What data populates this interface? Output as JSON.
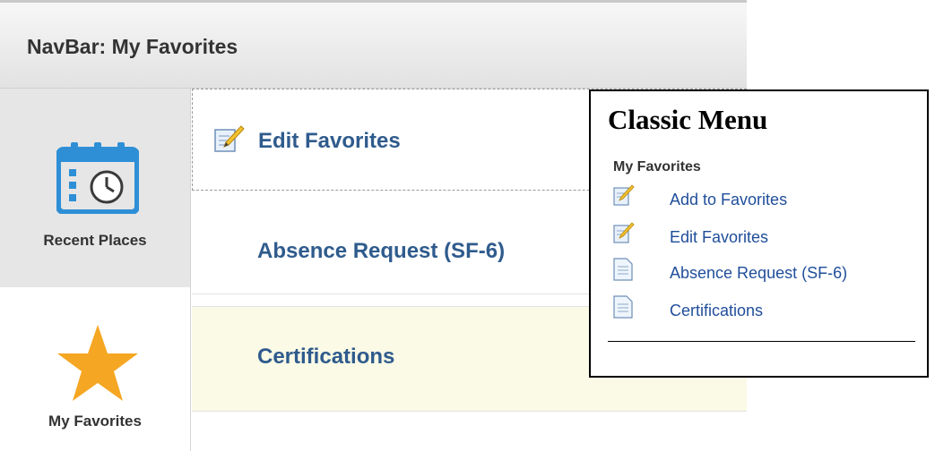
{
  "navbar": {
    "title": "NavBar: My Favorites",
    "rail": [
      {
        "label": "Recent Places",
        "icon": "calendar-clock-icon"
      },
      {
        "label": "My Favorites",
        "icon": "star-icon"
      }
    ],
    "favorites": [
      {
        "label": "Edit Favorites",
        "icon": "edit-pencil-icon"
      },
      {
        "label": "Absence Request (SF-6)"
      },
      {
        "label": "Certifications"
      }
    ]
  },
  "classic_menu": {
    "title": "Classic Menu",
    "subtitle": "My Favorites",
    "items": [
      {
        "label": "Add to Favorites",
        "icon": "edit-pencil-icon"
      },
      {
        "label": "Edit Favorites",
        "icon": "edit-pencil-icon"
      },
      {
        "label": "Absence Request (SF-6)",
        "icon": "document-icon"
      },
      {
        "label": "Certifications",
        "icon": "document-icon"
      }
    ]
  },
  "colors": {
    "link_blue": "#2f5b8d",
    "menu_link_blue": "#1f4e9a",
    "icon_blue": "#2e8fd6",
    "star_orange": "#f5a623",
    "selected_row": "#fafae6"
  }
}
